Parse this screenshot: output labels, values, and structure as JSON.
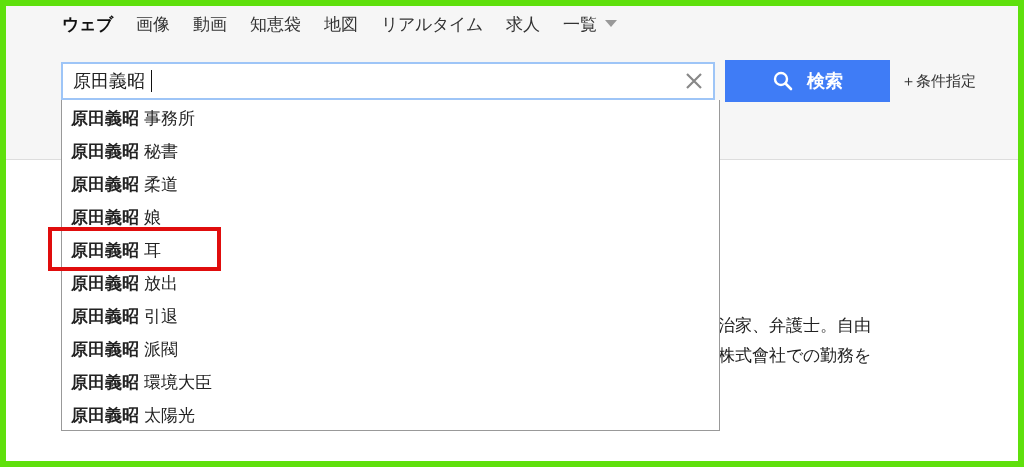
{
  "nav_tabs": [
    {
      "label": "ウェブ",
      "selected": true
    },
    {
      "label": "画像",
      "selected": false
    },
    {
      "label": "動画",
      "selected": false
    },
    {
      "label": "知恵袋",
      "selected": false
    },
    {
      "label": "地図",
      "selected": false
    },
    {
      "label": "リアルタイム",
      "selected": false
    },
    {
      "label": "求人",
      "selected": false
    },
    {
      "label": "一覧",
      "selected": false,
      "kind": "menu"
    }
  ],
  "search": {
    "value": "原田義昭 ",
    "button": "検索",
    "options_link": "＋条件指定"
  },
  "suggestions": [
    {
      "text": "**原田義昭** 事務所",
      "highlighted": false
    },
    {
      "text": "**原田義昭** 秘書",
      "highlighted": false
    },
    {
      "text": "**原田義昭** 柔道",
      "highlighted": false
    },
    {
      "text": "**原田義昭** 娘",
      "highlighted": false
    },
    {
      "text": "**原田義昭** 耳",
      "highlighted": true
    },
    {
      "text": "**原田義昭** 放出",
      "highlighted": false
    },
    {
      "text": "**原田義昭** 引退",
      "highlighted": false
    },
    {
      "text": "**原田義昭** 派閥",
      "highlighted": false
    },
    {
      "text": "**原田義昭** 環境大臣",
      "highlighted": false
    },
    {
      "text": "**原田義昭** 太陽光",
      "highlighted": false
    }
  ],
  "result_snippet": [
    "治家、弁護士。自由",
    "株式會社での勤務を"
  ]
}
